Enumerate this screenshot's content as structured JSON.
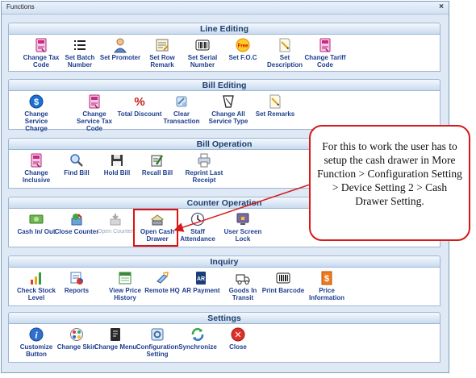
{
  "window": {
    "title": "Functions",
    "close": "×"
  },
  "sections": {
    "line_editing": {
      "title": "Line Editing",
      "items": [
        {
          "label": "Change Tax Code",
          "icon": "tax-document-icon"
        },
        {
          "label": "Set Batch Number",
          "icon": "list-icon"
        },
        {
          "label": "Set Promoter",
          "icon": "person-icon"
        },
        {
          "label": "Set Row Remark",
          "icon": "note-icon"
        },
        {
          "label": "Set Serial Number",
          "icon": "barcode-icon"
        },
        {
          "label": "Set F.O.C",
          "icon": "free-badge-icon",
          "badge": "Free"
        },
        {
          "label": "Set Description",
          "icon": "pencil-note-icon"
        },
        {
          "label": "Change Tariff Code",
          "icon": "tax-document-icon"
        }
      ]
    },
    "bill_editing": {
      "title": "Bill Editing",
      "items": [
        {
          "label": "Change Service Charge",
          "icon": "dollar-icon",
          "symbol": "$"
        },
        {
          "label": "Change Service Tax Code",
          "icon": "tax-document-icon"
        },
        {
          "label": "Total Discount",
          "icon": "percent-icon",
          "symbol": "%"
        },
        {
          "label": "Clear Transaction",
          "icon": "eraser-icon"
        },
        {
          "label": "Change All Service Type",
          "icon": "service-type-icon"
        },
        {
          "label": "Set Remarks",
          "icon": "pencil-note-icon"
        }
      ]
    },
    "bill_operation": {
      "title": "Bill Operation",
      "items": [
        {
          "label": "Change Inclusive",
          "icon": "tax-document-icon"
        },
        {
          "label": "Find Bill",
          "icon": "magnifier-icon"
        },
        {
          "label": "Hold Bill",
          "icon": "floppy-disk-icon"
        },
        {
          "label": "Recall Bill",
          "icon": "recall-icon"
        },
        {
          "label": "Reprint Last Receipt",
          "icon": "printer-icon"
        }
      ]
    },
    "counter_operation": {
      "title": "Counter Operation",
      "items": [
        {
          "label": "Cash In/ Out",
          "icon": "cash-icon"
        },
        {
          "label": "Close Counter",
          "icon": "close-counter-icon"
        },
        {
          "label": "Open Counter",
          "icon": "open-counter-icon",
          "disabled": true
        },
        {
          "label": "Open Cash Drawer",
          "icon": "cash-drawer-icon",
          "highlighted": true
        },
        {
          "label": "Staff Attendance",
          "icon": "clock-icon"
        },
        {
          "label": "User Screen Lock",
          "icon": "lock-screen-icon"
        }
      ]
    },
    "inquiry": {
      "title": "Inquiry",
      "items": [
        {
          "label": "Check Stock Level",
          "icon": "bar-chart-icon"
        },
        {
          "label": "Reports",
          "icon": "reports-icon"
        },
        {
          "label": "View Price History",
          "icon": "calendar-icon"
        },
        {
          "label": "Remote HQ",
          "icon": "remote-icon"
        },
        {
          "label": "AR Payment",
          "icon": "ar-book-icon",
          "symbol": "AR"
        },
        {
          "label": "Goods In Transit",
          "icon": "truck-icon"
        },
        {
          "label": "Print Barcode",
          "icon": "barcode-icon"
        },
        {
          "label": "Price Information",
          "icon": "price-tag-icon",
          "symbol": "$"
        }
      ]
    },
    "settings": {
      "title": "Settings",
      "items": [
        {
          "label": "Customize Button",
          "icon": "info-icon",
          "symbol": "i"
        },
        {
          "label": "Change Skin",
          "icon": "palette-icon"
        },
        {
          "label": "Change Menu",
          "icon": "menu-icon"
        },
        {
          "label": "Configuration Setting",
          "icon": "config-icon"
        },
        {
          "label": "Synchronize",
          "icon": "sync-icon"
        },
        {
          "label": "Close",
          "icon": "close-icon",
          "symbol": "✕"
        }
      ]
    }
  },
  "callout": {
    "text": "For this to work the user has to setup the cash drawer in More Function > Configuration Setting > Device Setting 2 > Cash Drawer Setting."
  },
  "colors": {
    "accent": "#1f3f8f",
    "header": "#1d3f6e",
    "highlight": "#e01010"
  }
}
